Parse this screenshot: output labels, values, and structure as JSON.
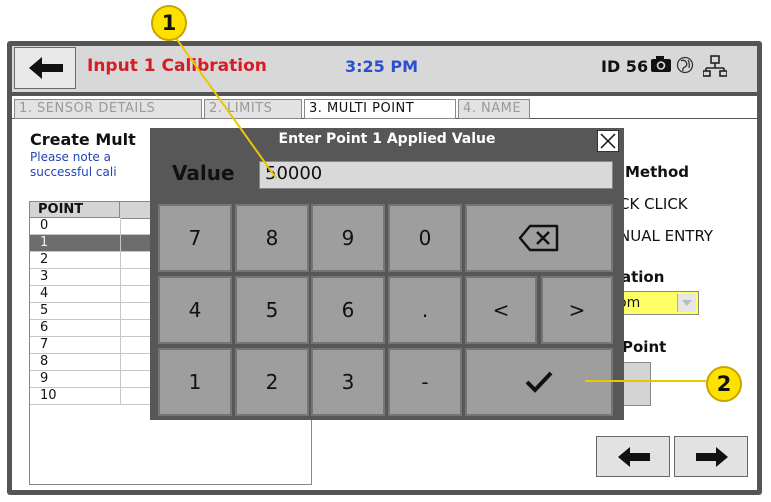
{
  "topbar": {
    "title": "Input 1 Calibration",
    "time": "3:25 PM",
    "device_id": "ID 56"
  },
  "tabs": [
    {
      "label": "1. SENSOR DETAILS"
    },
    {
      "label": "2. LIMITS"
    },
    {
      "label": "3. MULTI POINT"
    },
    {
      "label": "4. NAME"
    }
  ],
  "main": {
    "heading": "Create Mult",
    "note_line1": "Please note a",
    "note_line2": "successful cali",
    "table_header": "POINT",
    "rows": [
      "0",
      "1",
      "2",
      "3",
      "4",
      "5",
      "6",
      "7",
      "8",
      "9",
      "10"
    ],
    "selected_row": 1
  },
  "side": {
    "method_label": "Method",
    "method_option1": "CK CLICK",
    "method_option2": "NUAL ENTRY",
    "unit_label": "ation",
    "unit_value": "om",
    "point_label": "Point"
  },
  "keypad": {
    "title": "Enter Point 1 Applied Value",
    "value_label": "Value",
    "value": "50000",
    "keys_row1": [
      "7",
      "8",
      "9",
      "0"
    ],
    "keys_row2": [
      "4",
      "5",
      "6",
      "."
    ],
    "keys_row3": [
      "1",
      "2",
      "3",
      "-"
    ],
    "lt": "<",
    "gt": ">"
  },
  "callouts": {
    "one": "1",
    "two": "2"
  },
  "colors": {
    "title_red": "#d61c24",
    "time_blue": "#2a4fcf",
    "callout_yellow": "#ffe100",
    "selected_row": "#6d6d6d"
  }
}
